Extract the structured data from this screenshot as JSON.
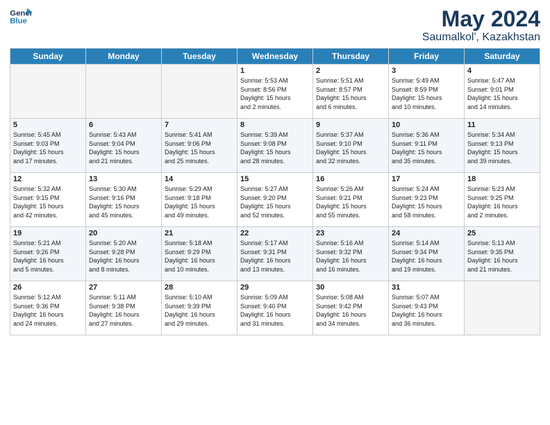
{
  "logo": {
    "line1": "General",
    "line2": "Blue"
  },
  "title": "May 2024",
  "subtitle": "Saumalkol', Kazakhstan",
  "weekdays": [
    "Sunday",
    "Monday",
    "Tuesday",
    "Wednesday",
    "Thursday",
    "Friday",
    "Saturday"
  ],
  "weeks": [
    [
      {
        "day": "",
        "info": ""
      },
      {
        "day": "",
        "info": ""
      },
      {
        "day": "",
        "info": ""
      },
      {
        "day": "1",
        "info": "Sunrise: 5:53 AM\nSunset: 8:56 PM\nDaylight: 15 hours\nand 2 minutes."
      },
      {
        "day": "2",
        "info": "Sunrise: 5:51 AM\nSunset: 8:57 PM\nDaylight: 15 hours\nand 6 minutes."
      },
      {
        "day": "3",
        "info": "Sunrise: 5:49 AM\nSunset: 8:59 PM\nDaylight: 15 hours\nand 10 minutes."
      },
      {
        "day": "4",
        "info": "Sunrise: 5:47 AM\nSunset: 9:01 PM\nDaylight: 15 hours\nand 14 minutes."
      }
    ],
    [
      {
        "day": "5",
        "info": "Sunrise: 5:45 AM\nSunset: 9:03 PM\nDaylight: 15 hours\nand 17 minutes."
      },
      {
        "day": "6",
        "info": "Sunrise: 5:43 AM\nSunset: 9:04 PM\nDaylight: 15 hours\nand 21 minutes."
      },
      {
        "day": "7",
        "info": "Sunrise: 5:41 AM\nSunset: 9:06 PM\nDaylight: 15 hours\nand 25 minutes."
      },
      {
        "day": "8",
        "info": "Sunrise: 5:39 AM\nSunset: 9:08 PM\nDaylight: 15 hours\nand 28 minutes."
      },
      {
        "day": "9",
        "info": "Sunrise: 5:37 AM\nSunset: 9:10 PM\nDaylight: 15 hours\nand 32 minutes."
      },
      {
        "day": "10",
        "info": "Sunrise: 5:36 AM\nSunset: 9:11 PM\nDaylight: 15 hours\nand 35 minutes."
      },
      {
        "day": "11",
        "info": "Sunrise: 5:34 AM\nSunset: 9:13 PM\nDaylight: 15 hours\nand 39 minutes."
      }
    ],
    [
      {
        "day": "12",
        "info": "Sunrise: 5:32 AM\nSunset: 9:15 PM\nDaylight: 15 hours\nand 42 minutes."
      },
      {
        "day": "13",
        "info": "Sunrise: 5:30 AM\nSunset: 9:16 PM\nDaylight: 15 hours\nand 45 minutes."
      },
      {
        "day": "14",
        "info": "Sunrise: 5:29 AM\nSunset: 9:18 PM\nDaylight: 15 hours\nand 49 minutes."
      },
      {
        "day": "15",
        "info": "Sunrise: 5:27 AM\nSunset: 9:20 PM\nDaylight: 15 hours\nand 52 minutes."
      },
      {
        "day": "16",
        "info": "Sunrise: 5:26 AM\nSunset: 9:21 PM\nDaylight: 15 hours\nand 55 minutes."
      },
      {
        "day": "17",
        "info": "Sunrise: 5:24 AM\nSunset: 9:23 PM\nDaylight: 15 hours\nand 58 minutes."
      },
      {
        "day": "18",
        "info": "Sunrise: 5:23 AM\nSunset: 9:25 PM\nDaylight: 16 hours\nand 2 minutes."
      }
    ],
    [
      {
        "day": "19",
        "info": "Sunrise: 5:21 AM\nSunset: 9:26 PM\nDaylight: 16 hours\nand 5 minutes."
      },
      {
        "day": "20",
        "info": "Sunrise: 5:20 AM\nSunset: 9:28 PM\nDaylight: 16 hours\nand 8 minutes."
      },
      {
        "day": "21",
        "info": "Sunrise: 5:18 AM\nSunset: 9:29 PM\nDaylight: 16 hours\nand 10 minutes."
      },
      {
        "day": "22",
        "info": "Sunrise: 5:17 AM\nSunset: 9:31 PM\nDaylight: 16 hours\nand 13 minutes."
      },
      {
        "day": "23",
        "info": "Sunrise: 5:16 AM\nSunset: 9:32 PM\nDaylight: 16 hours\nand 16 minutes."
      },
      {
        "day": "24",
        "info": "Sunrise: 5:14 AM\nSunset: 9:34 PM\nDaylight: 16 hours\nand 19 minutes."
      },
      {
        "day": "25",
        "info": "Sunrise: 5:13 AM\nSunset: 9:35 PM\nDaylight: 16 hours\nand 21 minutes."
      }
    ],
    [
      {
        "day": "26",
        "info": "Sunrise: 5:12 AM\nSunset: 9:36 PM\nDaylight: 16 hours\nand 24 minutes."
      },
      {
        "day": "27",
        "info": "Sunrise: 5:11 AM\nSunset: 9:38 PM\nDaylight: 16 hours\nand 27 minutes."
      },
      {
        "day": "28",
        "info": "Sunrise: 5:10 AM\nSunset: 9:39 PM\nDaylight: 16 hours\nand 29 minutes."
      },
      {
        "day": "29",
        "info": "Sunrise: 5:09 AM\nSunset: 9:40 PM\nDaylight: 16 hours\nand 31 minutes."
      },
      {
        "day": "30",
        "info": "Sunrise: 5:08 AM\nSunset: 9:42 PM\nDaylight: 16 hours\nand 34 minutes."
      },
      {
        "day": "31",
        "info": "Sunrise: 5:07 AM\nSunset: 9:43 PM\nDaylight: 16 hours\nand 36 minutes."
      },
      {
        "day": "",
        "info": ""
      }
    ]
  ]
}
